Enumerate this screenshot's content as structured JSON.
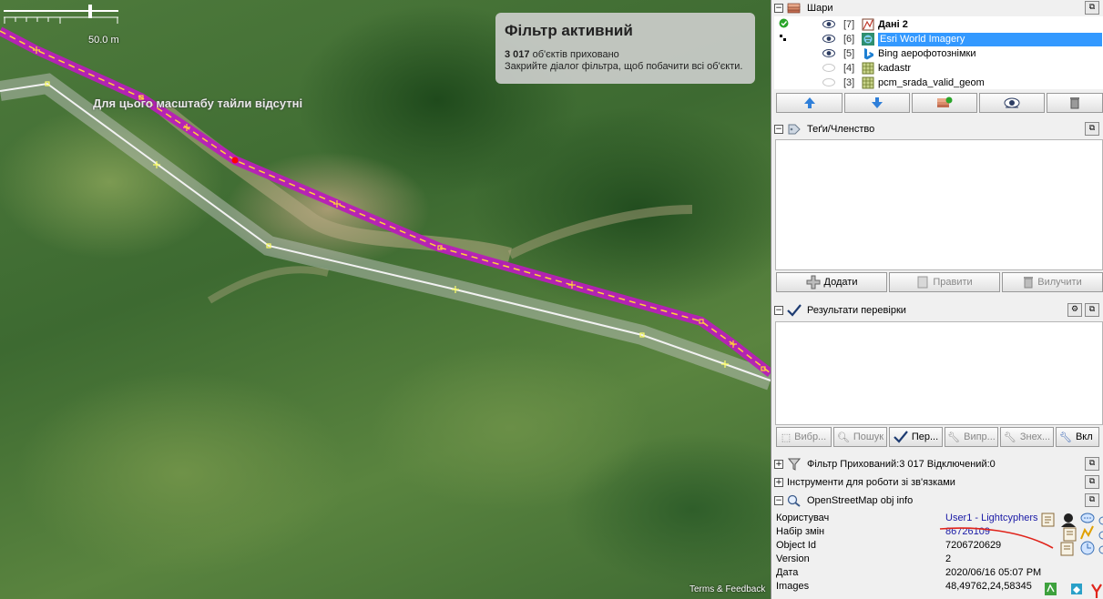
{
  "map": {
    "scale_label": "50.0 m",
    "tiles_missing_text": "Для цього масштабу тайли відсутні",
    "filter_box": {
      "title": "Фільтр активний",
      "hidden_count": "3 017",
      "hidden_text": "об'єктів приховано",
      "hint": "Закрийте діалог фільтра, щоб побачити всі об'єкти."
    },
    "terms": "Terms & Feedback"
  },
  "layers_panel": {
    "title": "Шари",
    "layers": [
      {
        "num": "[7]",
        "name": "Дані 2",
        "bold": true,
        "active": true,
        "visible": true,
        "icon": "data-layer-icon"
      },
      {
        "num": "[6]",
        "name": "Esri World Imagery",
        "selected": true,
        "visible": true,
        "icon": "esri-icon"
      },
      {
        "num": "[5]",
        "name": "Bing аерофотознімки",
        "visible": true,
        "icon": "bing-icon"
      },
      {
        "num": "[4]",
        "name": "kadastr",
        "visible": false,
        "icon": "grid-icon"
      },
      {
        "num": "[3]",
        "name": "pcm_srada_valid_geom",
        "visible": false,
        "icon": "grid-icon"
      }
    ]
  },
  "tags_panel": {
    "title": "Теґи/Членство",
    "buttons": {
      "add": "Додати",
      "edit": "Правити",
      "delete": "Вилучити"
    }
  },
  "validation_panel": {
    "title": "Результати перевірки",
    "buttons": {
      "select": "Вибр...",
      "search": "Пошук",
      "check": "Пер...",
      "fix": "Випр...",
      "ignore": "Знех...",
      "on": "Вкл"
    }
  },
  "filter_panel": {
    "title": "Фільтр Прихований:3 017 Відключений:0"
  },
  "relations_panel": {
    "title": "Інструменти для роботи зі зв'язками"
  },
  "osm_info_panel": {
    "title": "OpenStreetMap obj info",
    "rows": [
      {
        "key": "Користувач",
        "value": "User1 - Lightcyphers",
        "link": true
      },
      {
        "key": "Набір змін",
        "value": "86726109",
        "link": true
      },
      {
        "key": "Object Id",
        "value": "7206720629"
      },
      {
        "key": "Version",
        "value": "2"
      },
      {
        "key": "Дата",
        "value": "2020/06/16 05:07 PM"
      },
      {
        "key": "Images",
        "value": "48,49762,24,58345"
      }
    ]
  },
  "colors": {
    "route": "#b81fb8",
    "route_dash": "#ffd23a",
    "boundary": "#f2f2f2",
    "selection": "#3399ff",
    "annotation": "#e0241b"
  }
}
